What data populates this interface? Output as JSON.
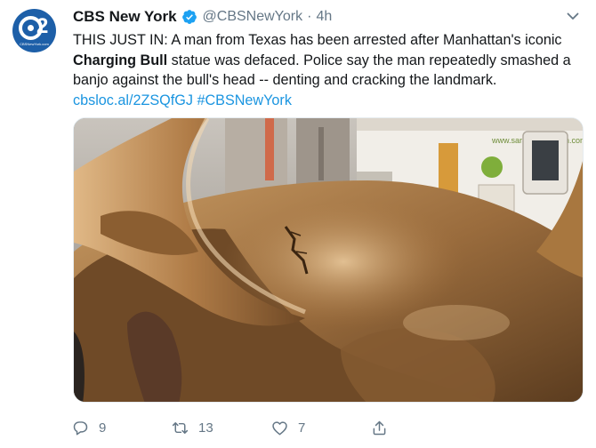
{
  "account": {
    "name": "CBS New York",
    "handle": "@CBSNewYork",
    "separator": "·",
    "time": "4h",
    "avatar_number": "2",
    "avatar_site": "CBSNewYork.com"
  },
  "tweet": {
    "text_part1": "THIS JUST IN: A man from Texas has been arrested after Manhattan's iconic ",
    "text_bold": "Charging Bull",
    "text_part2": " statue was defaced. Police say the man repeatedly smashed a banjo against the bull's head -- denting and cracking the landmark. ",
    "link": "cbsloc.al/2ZSQfGJ",
    "hashtag": "#CBSNewYork"
  },
  "media": {
    "truck_text": "www.saraswatihariom.com"
  },
  "actions": {
    "reply_count": "9",
    "retweet_count": "13",
    "like_count": "7"
  },
  "colors": {
    "link": "#1b95e0",
    "secondary": "#657786",
    "verified": "#1da1f2",
    "avatar_bg": "#1d5fa8"
  },
  "icons": [
    "verified-badge-icon",
    "caret-down-icon",
    "reply-icon",
    "retweet-icon",
    "like-icon",
    "share-icon"
  ]
}
